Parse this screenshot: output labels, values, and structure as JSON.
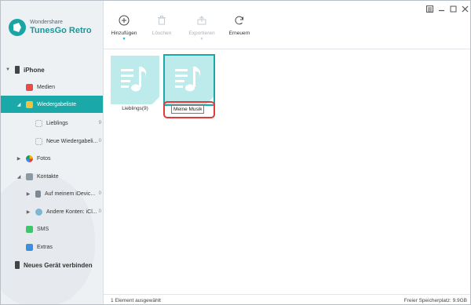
{
  "app": {
    "brand": "Wondershare",
    "product": "TunesGo Retro"
  },
  "colors": {
    "accent": "#1aa8a8",
    "highlight_ring": "#e03a3a",
    "tile_fill": "#bdeaea",
    "tile_note": "#ffffff"
  },
  "sidebar": {
    "items": [
      {
        "label": "iPhone",
        "icon": "phone-icon",
        "caret": "▼",
        "count": ""
      },
      {
        "label": "Medien",
        "icon": "music-icon",
        "caret": "",
        "count": ""
      },
      {
        "label": "Wiedergabeliste",
        "icon": "playlist-icon",
        "caret": "◢",
        "count": ""
      },
      {
        "label": "Lieblings",
        "icon": "playlist-item-icon",
        "caret": "",
        "count": "9"
      },
      {
        "label": "Neue Wiedergabeli...",
        "icon": "playlist-item-icon",
        "caret": "",
        "count": "0"
      },
      {
        "label": "Fotos",
        "icon": "photos-icon",
        "caret": "▶",
        "count": ""
      },
      {
        "label": "Kontakte",
        "icon": "contacts-icon",
        "caret": "◢",
        "count": ""
      },
      {
        "label": "Auf meinem iDevic...",
        "icon": "device-contacts-icon",
        "caret": "▶",
        "count": "0"
      },
      {
        "label": "Andere Konten: iCl...",
        "icon": "cloud-contacts-icon",
        "caret": "▶",
        "count": "0"
      },
      {
        "label": "SMS",
        "icon": "sms-icon",
        "caret": "",
        "count": ""
      },
      {
        "label": "Extras",
        "icon": "extras-icon",
        "caret": "",
        "count": ""
      },
      {
        "label": "Neues Gerät verbinden",
        "icon": "connect-device-icon",
        "caret": "",
        "count": ""
      }
    ]
  },
  "toolbar": {
    "add_label": "Hinzufügen",
    "delete_label": "Löschen",
    "export_label": "Exportieren",
    "refresh_label": "Erneuern"
  },
  "window_controls": {
    "menu_icon": "menu-icon",
    "minimize_icon": "minimize-icon",
    "maximize_icon": "maximize-icon",
    "close_icon": "close-icon"
  },
  "playlists": [
    {
      "name": "Lieblings(9)",
      "selected": false
    },
    {
      "name": "",
      "selected": true
    }
  ],
  "rename": {
    "value": "Meine Musik"
  },
  "status": {
    "selection": "1 Element ausgewählt",
    "free_space": "Freier Speicherplatz: 9.9GB"
  }
}
